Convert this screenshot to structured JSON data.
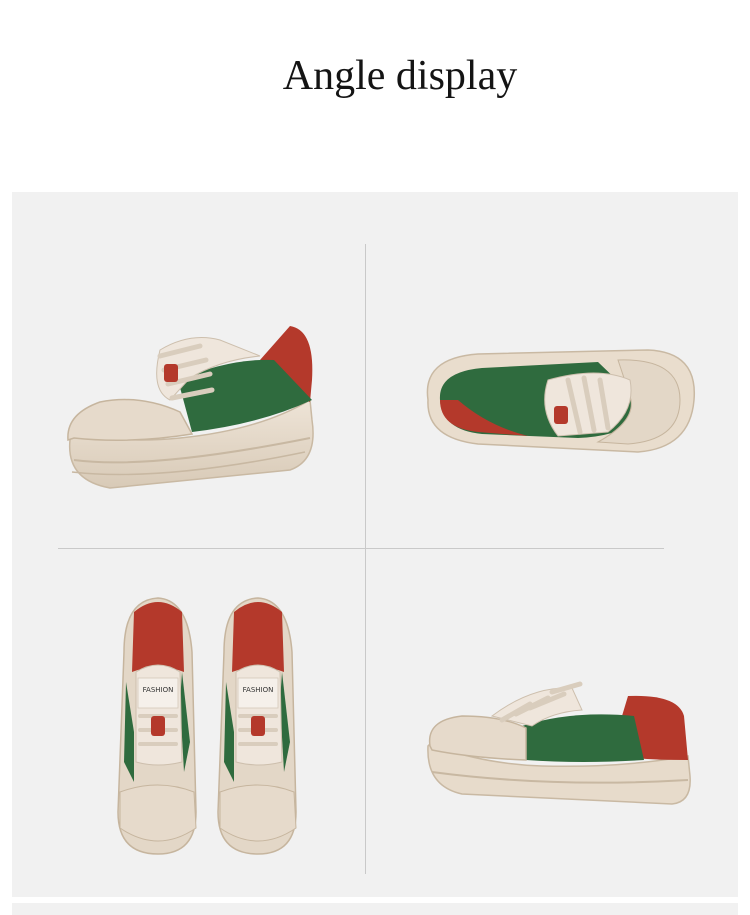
{
  "header": {
    "title": "Angle display"
  },
  "product_views": [
    {
      "name": "side-three-quarter-view",
      "colors": {
        "sole": "#e7dbcb",
        "upper": "#e9ddd0",
        "suede": "#2f6b3e",
        "heel": "#b4392b"
      }
    },
    {
      "name": "top-inverted-view",
      "colors": {
        "sole": "#e7dbcb",
        "upper": "#e9ddd0",
        "suede": "#2f6b3e",
        "heel": "#b4392b"
      }
    },
    {
      "name": "front-pair-view",
      "label": "FASHION",
      "colors": {
        "sole": "#e7dbcb",
        "upper": "#e9ddd0",
        "suede": "#2f6b3e",
        "heel": "#b4392b"
      }
    },
    {
      "name": "side-profile-view",
      "colors": {
        "sole": "#e7dbcb",
        "upper": "#e9ddd0",
        "suede": "#2f6b3e",
        "heel": "#b4392b"
      }
    }
  ],
  "colors": {
    "panel_bg": "#f1f1f1",
    "divider": "#c9c9c9"
  }
}
